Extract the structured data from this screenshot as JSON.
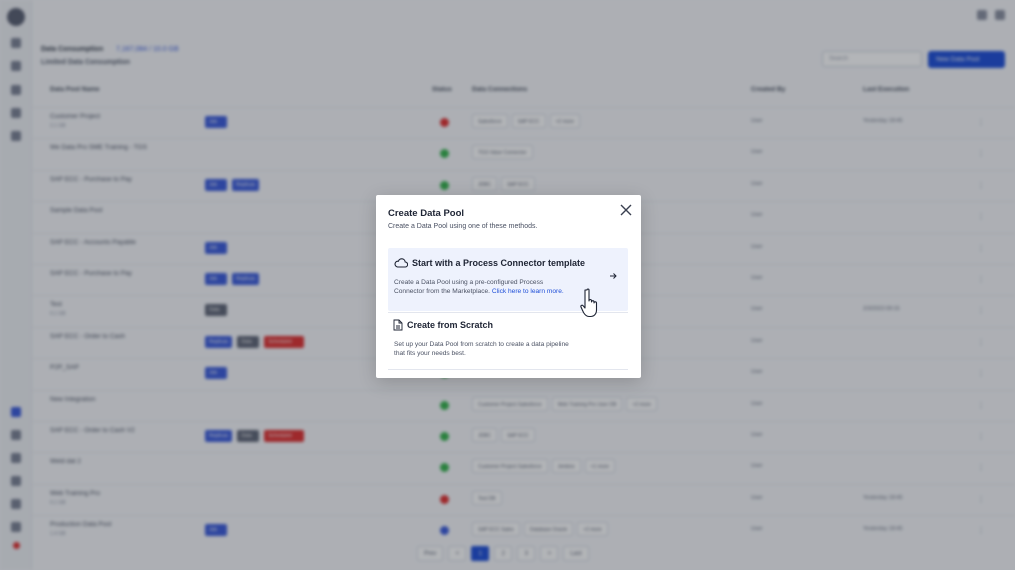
{
  "app": {
    "header": {
      "title": "Data Consumption",
      "link": "7,167,084 / 10.0 GB",
      "subtitle": "Limited Data Consumption"
    },
    "search_placeholder": "Search",
    "new_button_label": "New Data Pool",
    "columns": [
      "Data Pool Name",
      "Status",
      "Data Connections",
      "Created By",
      "Last Execution"
    ],
    "rows": [
      {
        "name": "Customer Project",
        "sub": "2.1 GB",
        "tags": [
          {
            "label": "Job",
            "color": "blue"
          }
        ],
        "status": "red",
        "conns": [
          "Salesforce",
          "SAP ECC",
          "+2 more"
        ],
        "by": "User",
        "exec": "Yesterday 18:45"
      },
      {
        "name": "We Data Pro SME Training - TGS",
        "sub": "",
        "tags": [],
        "status": "green",
        "conns": [
          "TGS Value Connector"
        ],
        "by": "User",
        "exec": ""
      },
      {
        "name": "SAP ECC - Purchase to Pay",
        "sub": "",
        "tags": [
          {
            "label": "Job",
            "color": "blue"
          },
          {
            "label": "Replicas",
            "color": "blue"
          }
        ],
        "status": "green",
        "conns": [
          "JDBC",
          "SAP ECC"
        ],
        "by": "User",
        "exec": ""
      },
      {
        "name": "Sample Data Pool",
        "sub": "",
        "tags": [],
        "status": "green",
        "conns": [],
        "by": "User",
        "exec": ""
      },
      {
        "name": "SAP ECC - Accounts Payable",
        "sub": "",
        "tags": [
          {
            "label": "Job",
            "color": "blue"
          }
        ],
        "status": "green",
        "conns": [],
        "by": "User",
        "exec": ""
      },
      {
        "name": "SAP ECC - Purchase to Pay",
        "sub": "",
        "tags": [
          {
            "label": "Job",
            "color": "blue"
          },
          {
            "label": "Replicas",
            "color": "blue"
          }
        ],
        "status": "green",
        "conns": [],
        "by": "User",
        "exec": ""
      },
      {
        "name": "Test",
        "sub": "0.1 GB",
        "tags": [
          {
            "label": "Data",
            "color": "gray"
          }
        ],
        "status": "green",
        "conns": [],
        "by": "User",
        "exec": "2/3/2023 09:15"
      },
      {
        "name": "SAP ECC - Order to Cash",
        "sub": "",
        "tags": [
          {
            "label": "Replicas",
            "color": "blue"
          },
          {
            "label": "Data",
            "color": "gray"
          },
          {
            "label": "Scheduled",
            "color": "red"
          }
        ],
        "status": "green",
        "conns": [],
        "by": "User",
        "exec": ""
      },
      {
        "name": "P2P_SAP",
        "sub": "",
        "tags": [
          {
            "label": "Job",
            "color": "blue"
          }
        ],
        "status": "green",
        "conns": [],
        "by": "User",
        "exec": ""
      },
      {
        "name": "New Integration",
        "sub": "",
        "tags": [],
        "status": "green",
        "conns": [
          "Customer Project Salesforce",
          "Web Training Pro User DB",
          "+2 more"
        ],
        "by": "User",
        "exec": ""
      },
      {
        "name": "SAP ECC - Order to Cash V2",
        "sub": "",
        "tags": [
          {
            "label": "Replicas",
            "color": "blue"
          },
          {
            "label": "Data",
            "color": "gray"
          },
          {
            "label": "Scheduled",
            "color": "red"
          }
        ],
        "status": "green",
        "conns": [
          "JDBC",
          "SAP ECC"
        ],
        "by": "User",
        "exec": ""
      },
      {
        "name": "Weld dat 2",
        "sub": "",
        "tags": [],
        "status": "green",
        "conns": [
          "Customer Project Salesforce",
          "Jenkins",
          "+1 more"
        ],
        "by": "User",
        "exec": ""
      },
      {
        "name": "Web Training Pro",
        "sub": "0.1 GB",
        "tags": [],
        "status": "red",
        "conns": [
          "Test DB"
        ],
        "by": "User",
        "exec": "Yesterday 18:45"
      },
      {
        "name": "Production Data Pool",
        "sub": "1.4 GB",
        "tags": [
          {
            "label": "Job",
            "color": "blue"
          }
        ],
        "status": "blue",
        "conns": [
          "SAP ECC Sales",
          "Database Oracle",
          "+2 more"
        ],
        "by": "User",
        "exec": "Yesterday 18:45"
      }
    ],
    "pager": [
      "Prev",
      "<",
      "1",
      "2",
      "3",
      ">",
      "Last"
    ]
  },
  "modal": {
    "title": "Create Data Pool",
    "subtitle": "Create a Data Pool using one of these methods.",
    "option_template": {
      "title": "Start with a Process Connector template",
      "description": "Create a Data Pool using a pre-configured Process Connector from the Marketplace.",
      "link": "Click here to learn more."
    },
    "option_scratch": {
      "title": "Create from Scratch",
      "description": "Set up your Data Pool from scratch to create a data pipeline that fits your needs best."
    }
  },
  "icons": {
    "close": "close-icon",
    "cloud": "cloud-icon",
    "arrow": "arrow-right-icon",
    "document": "document-icon",
    "cursor": "hand-pointer-cursor"
  },
  "colors": {
    "accent": "#1f4fd8",
    "option_highlight": "#eef2fd",
    "status_red": "#e03131",
    "status_green": "#37b24d"
  }
}
